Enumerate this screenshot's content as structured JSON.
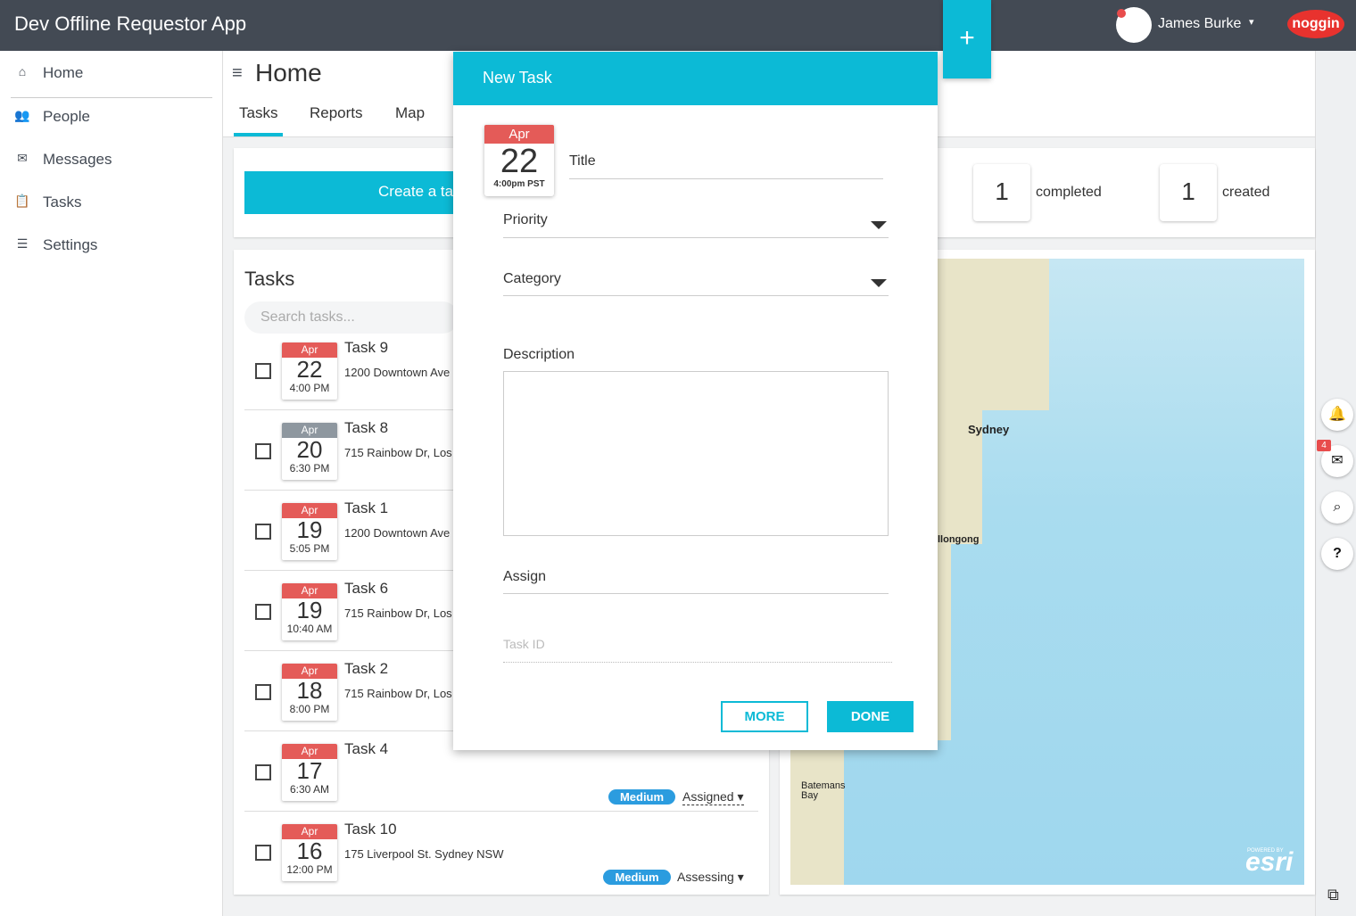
{
  "app": {
    "title": "Dev Offline Requestor App"
  },
  "topbar": {
    "add_label": "+",
    "user_name": "James Burke",
    "user_caret": "▾",
    "logo_text": "noggin"
  },
  "sidebar": {
    "items": [
      {
        "label": "Home",
        "icon": "home-icon",
        "glyph": "⌂"
      },
      {
        "label": "People",
        "icon": "people-icon",
        "glyph": "👥"
      },
      {
        "label": "Messages",
        "icon": "envelope-icon",
        "glyph": "✉"
      },
      {
        "label": "Tasks",
        "icon": "clipboard-icon",
        "glyph": "📋"
      },
      {
        "label": "Settings",
        "icon": "sliders-icon",
        "glyph": "☰"
      }
    ]
  },
  "header": {
    "menu_glyph": "≡",
    "title": "Home",
    "tabs": [
      {
        "label": "Tasks"
      },
      {
        "label": "Reports"
      },
      {
        "label": "Map"
      }
    ],
    "active_tab": "Tasks"
  },
  "summary": {
    "create_label": "Create a task",
    "completed": {
      "count": "1",
      "label": "completed"
    },
    "created": {
      "count": "1",
      "label": "created"
    }
  },
  "tasks_panel": {
    "title": "Tasks",
    "search_placeholder": "Search tasks..."
  },
  "tasks": [
    {
      "title": "Task 9",
      "address": "1200 Downtown Ave",
      "month": "Apr",
      "day": "22",
      "time": "4:00 PM",
      "overdue": false
    },
    {
      "title": "Task 8",
      "address": "715 Rainbow Dr, Los",
      "month": "Apr",
      "day": "20",
      "time": "6:30 PM",
      "overdue": true
    },
    {
      "title": "Task 1",
      "address": "1200 Downtown Ave",
      "month": "Apr",
      "day": "19",
      "time": "5:05 PM",
      "overdue": false
    },
    {
      "title": "Task 6",
      "address": "715 Rainbow Dr, Los",
      "month": "Apr",
      "day": "19",
      "time": "10:40 AM",
      "overdue": false
    },
    {
      "title": "Task 2",
      "address": "715 Rainbow Dr, Los",
      "month": "Apr",
      "day": "18",
      "time": "8:00 PM",
      "overdue": false
    },
    {
      "title": "Task 4",
      "address": "",
      "month": "Apr",
      "day": "17",
      "time": "6:30 AM",
      "priority": "Medium",
      "status": "Assigned",
      "overdue": false
    },
    {
      "title": "Task 10",
      "address": "175 Liverpool St. Sydney NSW",
      "month": "Apr",
      "day": "16",
      "time": "12:00 PM",
      "priority": "Medium",
      "status": "Assessing",
      "overdue": false
    }
  ],
  "map": {
    "labels": [
      "Sydney",
      "llongong",
      "Batemans Bay"
    ],
    "attribution_small": "POWERED BY",
    "attribution": "esri"
  },
  "right_toolbar": {
    "icons": [
      "bell-icon",
      "envelope-icon",
      "search-icon",
      "help-icon"
    ],
    "glyphs": [
      "🔔",
      "✉",
      "⌕",
      "?"
    ],
    "message_badge": "4"
  },
  "modal": {
    "title": "New Task",
    "date": {
      "month": "Apr",
      "day": "22",
      "time": "4:00pm PST"
    },
    "fields": {
      "title": "Title",
      "priority": "Priority",
      "category": "Category",
      "description": "Description",
      "assign": "Assign",
      "task_id_placeholder": "Task ID"
    },
    "buttons": {
      "more": "MORE",
      "done": "DONE"
    }
  },
  "colors": {
    "accent": "#0cbad6",
    "topbar": "#434a54",
    "date_header": "#e45b58",
    "priority": "#2b9cdf",
    "brand": "#e8322e"
  }
}
